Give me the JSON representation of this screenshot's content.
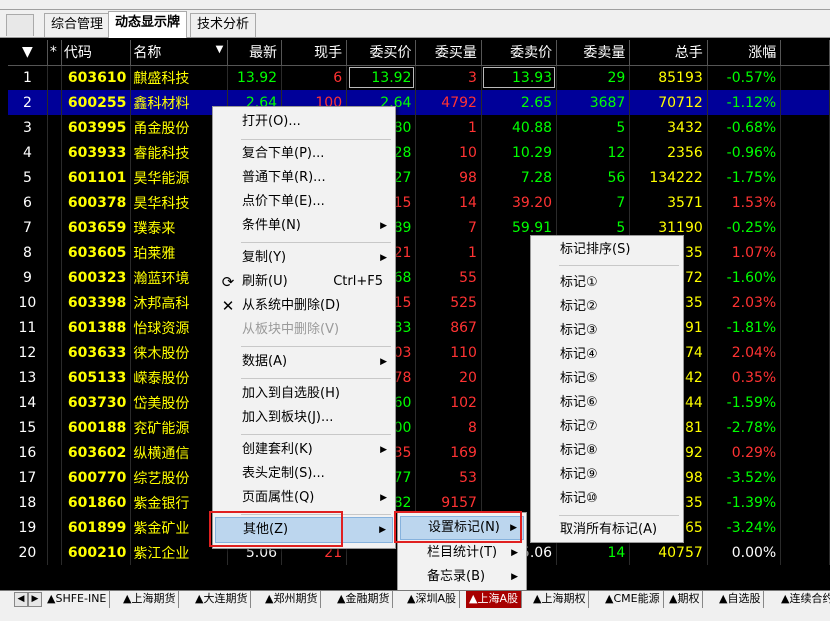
{
  "tabs": [
    "综合管理",
    "动态显示牌",
    "技术分析"
  ],
  "active_tab": "动态显示牌",
  "columns": [
    "*",
    "代码",
    "名称",
    "最新",
    "现手",
    "委买价",
    "委买量",
    "委卖价",
    "委卖量",
    "总手",
    "涨幅"
  ],
  "sort_arrow": "▼",
  "rows": [
    {
      "n": "1",
      "code": "603610",
      "name": "麒盛科技",
      "last": "13.92",
      "vol": "6",
      "bid": "13.92",
      "bidq": "3",
      "ask": "13.93",
      "askq": "29",
      "total": "85193",
      "chg": "-0.57%",
      "dir": "dn"
    },
    {
      "n": "2",
      "code": "600255",
      "name": "鑫科材料",
      "last": "2.64",
      "vol": "100",
      "bid": "2.64",
      "bidq": "4792",
      "ask": "2.65",
      "askq": "3687",
      "total": "70712",
      "chg": "-1.12%",
      "dir": "dn"
    },
    {
      "n": "3",
      "code": "603995",
      "name": "甬金股份",
      "last": "",
      "vol": "",
      "bid": "80",
      "bidq": "1",
      "ask": "40.88",
      "askq": "5",
      "total": "3432",
      "chg": "-0.68%",
      "dir": "dn"
    },
    {
      "n": "4",
      "code": "603933",
      "name": "睿能科技",
      "last": "",
      "vol": "",
      "bid": "28",
      "bidq": "10",
      "ask": "10.29",
      "askq": "12",
      "total": "2356",
      "chg": "-0.96%",
      "dir": "dn"
    },
    {
      "n": "5",
      "code": "601101",
      "name": "昊华能源",
      "last": "",
      "vol": "",
      "bid": "27",
      "bidq": "98",
      "ask": "7.28",
      "askq": "56",
      "total": "134222",
      "chg": "-1.75%",
      "dir": "dn"
    },
    {
      "n": "6",
      "code": "600378",
      "name": "昊华科技",
      "last": "",
      "vol": "",
      "bid": "15",
      "bidq": "14",
      "ask": "39.20",
      "askq": "7",
      "total": "3571",
      "chg": "1.53%",
      "dir": "up"
    },
    {
      "n": "7",
      "code": "603659",
      "name": "璞泰来",
      "last": "",
      "vol": "",
      "bid": "89",
      "bidq": "7",
      "ask": "59.91",
      "askq": "5",
      "total": "31190",
      "chg": "-0.25%",
      "dir": "dn"
    },
    {
      "n": "8",
      "code": "603605",
      "name": "珀莱雅",
      "last": "",
      "vol": "",
      "bid": "21",
      "bidq": "1",
      "ask": "16",
      "askq": "",
      "total": "835",
      "chg": "1.07%",
      "dir": "up"
    },
    {
      "n": "9",
      "code": "600323",
      "name": "瀚蓝环境",
      "last": "",
      "vol": "",
      "bid": "68",
      "bidq": "55",
      "ask": "",
      "askq": "",
      "total": "972",
      "chg": "-1.60%",
      "dir": "dn"
    },
    {
      "n": "10",
      "code": "603398",
      "name": "沐邦高科",
      "last": "",
      "vol": "",
      "bid": "15",
      "bidq": "525",
      "ask": "3",
      "askq": "",
      "total": "135",
      "chg": "2.03%",
      "dir": "up"
    },
    {
      "n": "11",
      "code": "601388",
      "name": "怡球资源",
      "last": "",
      "vol": "",
      "bid": "33",
      "bidq": "867",
      "ask": "",
      "askq": "",
      "total": "291",
      "chg": "-1.81%",
      "dir": "dn"
    },
    {
      "n": "12",
      "code": "603633",
      "name": "徕木股份",
      "last": "",
      "vol": "",
      "bid": "03",
      "bidq": "110",
      "ask": "",
      "askq": "",
      "total": "374",
      "chg": "2.04%",
      "dir": "up"
    },
    {
      "n": "13",
      "code": "605133",
      "name": "嵘泰股份",
      "last": "",
      "vol": "",
      "bid": "78",
      "bidq": "20",
      "ask": "",
      "askq": "",
      "total": "142",
      "chg": "0.35%",
      "dir": "up"
    },
    {
      "n": "14",
      "code": "603730",
      "name": "岱美股份",
      "last": "",
      "vol": "",
      "bid": "60",
      "bidq": "102",
      "ask": "",
      "askq": "",
      "total": "344",
      "chg": "-1.59%",
      "dir": "dn"
    },
    {
      "n": "15",
      "code": "600188",
      "name": "兖矿能源",
      "last": "",
      "vol": "",
      "bid": "00",
      "bidq": "8",
      "ask": "",
      "askq": "",
      "total": "781",
      "chg": "-2.78%",
      "dir": "dn"
    },
    {
      "n": "16",
      "code": "603602",
      "name": "纵横通信",
      "last": "",
      "vol": "",
      "bid": "35",
      "bidq": "169",
      "ask": "",
      "askq": "",
      "total": "592",
      "chg": "0.29%",
      "dir": "up"
    },
    {
      "n": "17",
      "code": "600770",
      "name": "综艺股份",
      "last": "",
      "vol": "",
      "bid": "77",
      "bidq": "53",
      "ask": "",
      "askq": "",
      "total": "098",
      "chg": "-3.52%",
      "dir": "dn"
    },
    {
      "n": "18",
      "code": "601860",
      "name": "紫金银行",
      "last": "",
      "vol": "",
      "bid": "82",
      "bidq": "9157",
      "ask": "",
      "askq": "",
      "total": "435",
      "chg": "-1.39%",
      "dir": "dn"
    },
    {
      "n": "19",
      "code": "601899",
      "name": "紫金矿业",
      "last": "",
      "vol": "",
      "bid": "",
      "bidq": "",
      "ask": "",
      "askq": "",
      "total": "165",
      "chg": "-3.24%",
      "dir": "dn"
    },
    {
      "n": "20",
      "code": "600210",
      "name": "紫江企业",
      "last": "5.06",
      "vol": "21",
      "bid": "",
      "bidq": "",
      "ask": "5.06",
      "askq": "14",
      "total": "40757",
      "chg": "0.00%",
      "dir": "wh"
    }
  ],
  "context_menu": {
    "items": [
      "打开(O)...",
      "复合下单(P)...",
      "普通下单(R)...",
      "点价下单(E)...",
      "条件单(N)",
      "复制(Y)",
      "刷新(U)",
      "从系统中删除(D)",
      "从板块中删除(V)",
      "数据(A)",
      "加入到自选股(H)",
      "加入到板块(J)...",
      "创建套利(K)",
      "表头定制(S)...",
      "页面属性(Q)",
      "其他(Z)"
    ],
    "refresh_shortcut": "Ctrl+F5"
  },
  "submenu_other": {
    "items": [
      "设置标记(N)",
      "栏目统计(T)",
      "备忘录(B)"
    ]
  },
  "submenu_marks": {
    "items": [
      "标记排序(S)",
      "标记①",
      "标记②",
      "标记③",
      "标记④",
      "标记⑤",
      "标记⑥",
      "标记⑦",
      "标记⑧",
      "标记⑨",
      "标记⑩",
      "取消所有标记(A)"
    ]
  },
  "bottom_tabs": [
    "▲SHFE-INE",
    "▲上海期货",
    "▲大连期货",
    "▲郑州期货",
    "▲金融期货",
    "▲深圳A股",
    "▲上海A股",
    "▲上海期权",
    "▲CME能源",
    "▲期权",
    "▲自选股",
    "▲连续合约"
  ],
  "active_bottom_tab": "▲上海A股",
  "colors": {
    "up": "#ff3333",
    "down": "#00ff00",
    "code": "#ffff00",
    "selected_row": "#000099",
    "menu_highlight": "#bcd6ee",
    "annotation": "#e02020"
  }
}
